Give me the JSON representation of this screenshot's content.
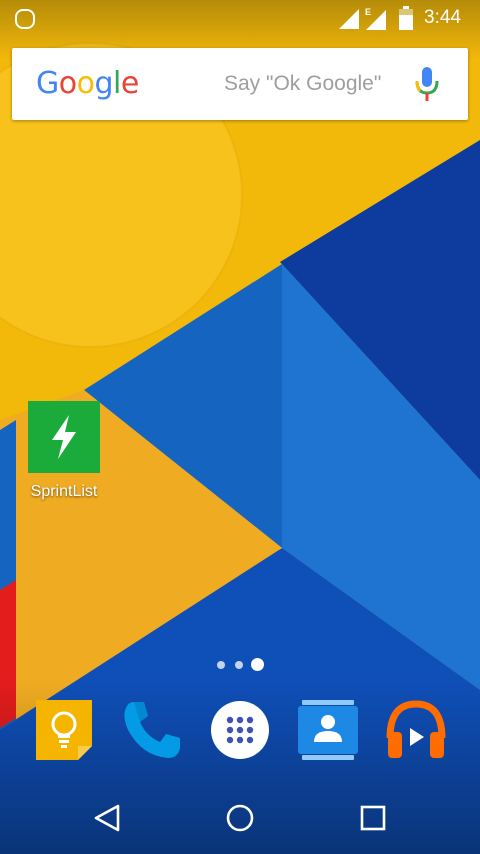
{
  "status_bar": {
    "time": "3:44",
    "network_type": "E",
    "icons": [
      "notification-icon",
      "signal-icon",
      "data-signal-icon",
      "battery-icon"
    ]
  },
  "search": {
    "logo_letters": [
      {
        "char": "G",
        "color": "#4285f4"
      },
      {
        "char": "o",
        "color": "#ea4335"
      },
      {
        "char": "o",
        "color": "#fbbc05"
      },
      {
        "char": "g",
        "color": "#4285f4"
      },
      {
        "char": "l",
        "color": "#34a853"
      },
      {
        "char": "e",
        "color": "#ea4335"
      }
    ],
    "hint": "Say \"Ok Google\"",
    "mic_icon": "mic-icon"
  },
  "desktop_apps": [
    {
      "label": "SprintList",
      "icon": "lightning-bolt-icon",
      "color": "#1aab3b"
    }
  ],
  "page_indicator": {
    "pages": 3,
    "current": 3
  },
  "dock": [
    {
      "name": "keep",
      "icon": "lightbulb-icon",
      "color": "#f4b400"
    },
    {
      "name": "phone",
      "icon": "phone-icon",
      "color": "#039be5"
    },
    {
      "name": "app-drawer",
      "icon": "app-drawer-icon",
      "color": "#ffffff"
    },
    {
      "name": "contacts",
      "icon": "contacts-icon",
      "color": "#1e88e5"
    },
    {
      "name": "play-music",
      "icon": "headphones-icon",
      "color": "#ff6d00"
    }
  ],
  "nav_bar": [
    "back-icon",
    "home-icon",
    "recents-icon"
  ],
  "colors": {
    "wallpaper_yellow": "#f2b90b",
    "wallpaper_blue": "#1565c0",
    "wallpaper_dark_blue": "#0d3c9e",
    "wallpaper_red": "#e31c1c"
  }
}
